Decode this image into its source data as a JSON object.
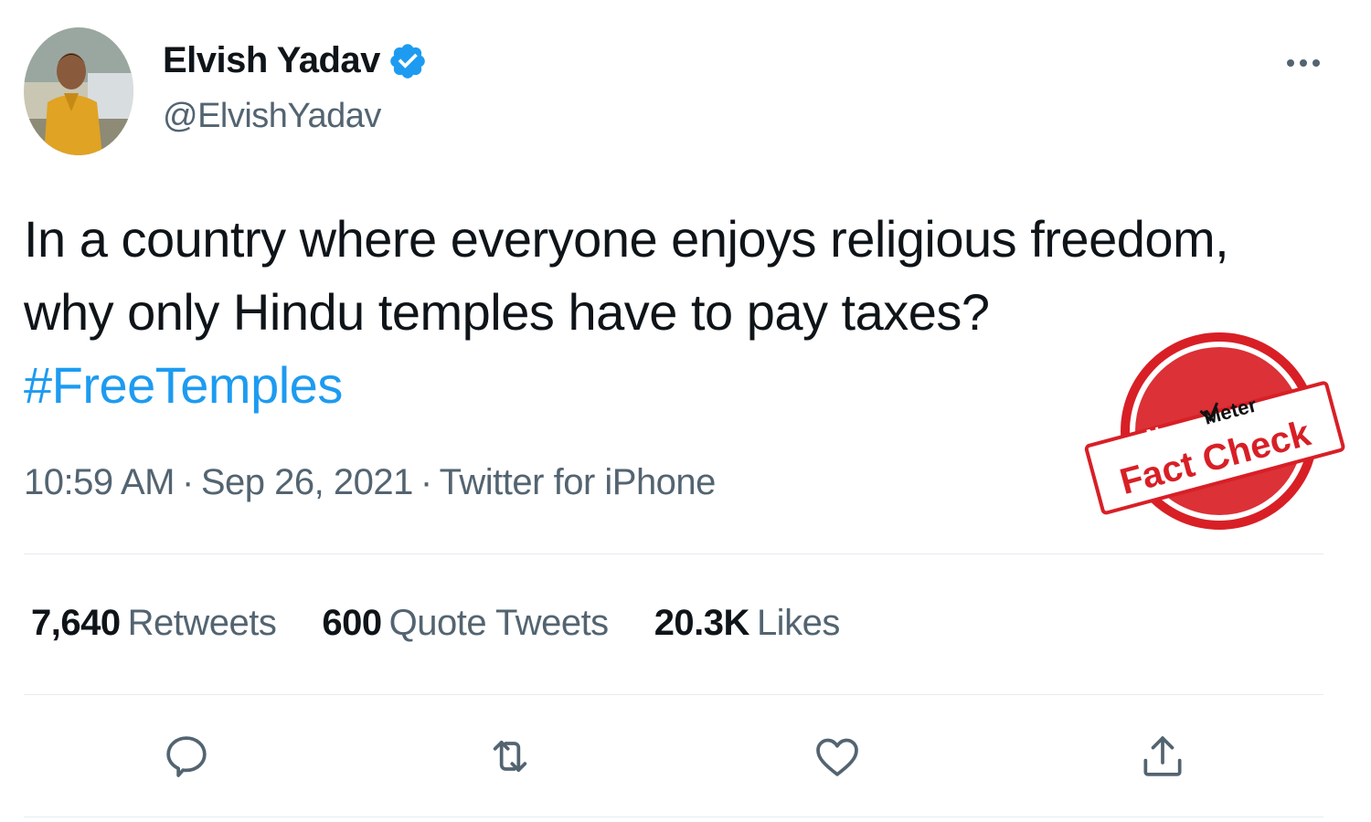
{
  "user": {
    "display_name": "Elvish Yadav",
    "handle": "@ElvishYadav",
    "verified": true
  },
  "tweet": {
    "line1": "In a country where everyone enjoys religious freedom,",
    "line2": "why only Hindu temples have to pay taxes?",
    "hashtag": "#FreeTemples",
    "time": "10:59 AM",
    "date": "Sep 26, 2021",
    "source": "Twitter for iPhone"
  },
  "stats": {
    "retweets": {
      "count": "7,640",
      "label": "Retweets"
    },
    "quotes": {
      "count": "600",
      "label": "Quote Tweets"
    },
    "likes": {
      "count": "20.3K",
      "label": "Likes"
    }
  },
  "icons": {
    "more": "more-options-icon",
    "reply": "reply-icon",
    "retweet": "retweet-icon",
    "like": "like-icon",
    "share": "share-icon",
    "verified": "verified-badge-icon"
  },
  "stamp": {
    "brand_news": "News",
    "brand_meter": "Meter",
    "label": "Fact Check"
  },
  "colors": {
    "accent": "#1d9bf0",
    "text": "#0f1419",
    "secondary": "#536471",
    "stamp_red": "#d81f26"
  }
}
